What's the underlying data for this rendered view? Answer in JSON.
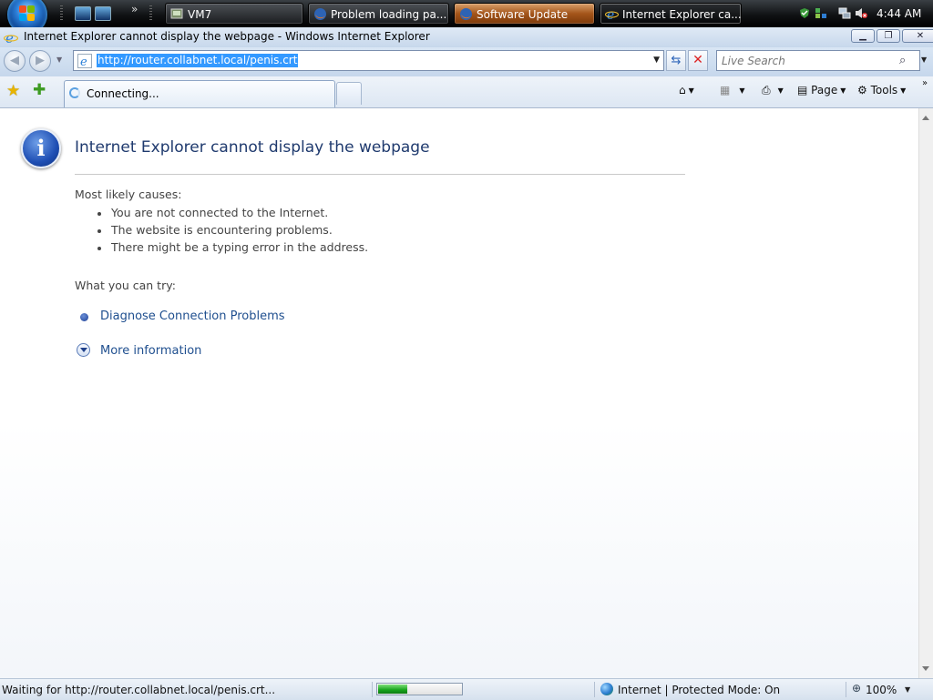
{
  "taskbar": {
    "buttons": [
      {
        "label": "VM7",
        "icon": "vm-icon"
      },
      {
        "label": "Problem loading pa...",
        "icon": "firefox-icon"
      },
      {
        "label": "Software Update",
        "icon": "firefox-icon"
      },
      {
        "label": "Internet Explorer ca...",
        "icon": "ie-icon"
      }
    ],
    "clock": "4:44 AM"
  },
  "window": {
    "title": "Internet Explorer cannot display the webpage - Windows Internet Explorer"
  },
  "address_bar": {
    "url": "http://router.collabnet.local/penis.crt"
  },
  "search": {
    "placeholder": "Live Search"
  },
  "tab": {
    "label": "Connecting..."
  },
  "command_bar": {
    "page": "Page",
    "tools": "Tools"
  },
  "page": {
    "title": "Internet Explorer cannot display the webpage",
    "causes_heading": "Most likely causes:",
    "causes": [
      "You are not connected to the Internet.",
      "The website is encountering problems.",
      "There might be a typing error in the address."
    ],
    "try_heading": "What you can try:",
    "diagnose_link": "Diagnose Connection Problems",
    "more_info_link": "More information"
  },
  "status_bar": {
    "text": "Waiting for http://router.collabnet.local/penis.crt...",
    "progress": 0.35,
    "zone": "Internet | Protected Mode: On",
    "zoom": "100%"
  },
  "colors": {
    "link": "#1f4f8f",
    "title": "#1f3a6e",
    "url_highlight": "#3399ff"
  }
}
